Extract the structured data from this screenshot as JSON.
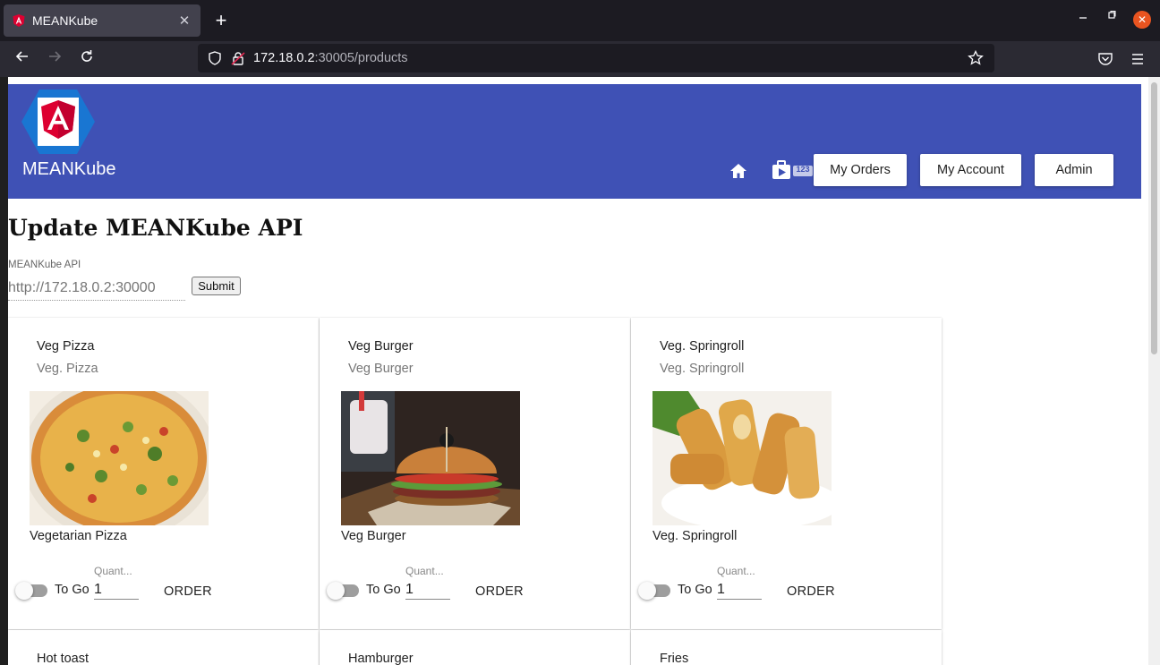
{
  "browser": {
    "tab_title": "MEANKube",
    "tab_close": "✕",
    "new_tab": "+",
    "url_host": "172.18.0.2",
    "url_path": ":30005/products"
  },
  "header": {
    "brand": "MEANKube",
    "buttons": [
      "My Orders",
      "My Account",
      "Admin"
    ],
    "badge": "123",
    "color": "#3f51b5"
  },
  "page": {
    "title": "Update MEANKube API",
    "api_label": "MEANKube API",
    "api_placeholder": "http://172.18.0.2:30000",
    "submit_label": "Submit"
  },
  "products": [
    {
      "title": "Veg Pizza",
      "subtitle": "Veg. Pizza",
      "description": "Vegetarian Pizza",
      "togo_label": "To Go",
      "qty_label": "Quant...",
      "qty": "1",
      "order_label": "ORDER"
    },
    {
      "title": "Veg Burger",
      "subtitle": "Veg Burger",
      "description": "Veg Burger",
      "togo_label": "To Go",
      "qty_label": "Quant...",
      "qty": "1",
      "order_label": "ORDER"
    },
    {
      "title": "Veg. Springroll",
      "subtitle": "Veg. Springroll",
      "description": "Veg. Springroll",
      "togo_label": "To Go",
      "qty_label": "Quant...",
      "qty": "1",
      "order_label": "ORDER"
    },
    {
      "title": "Hot toast"
    },
    {
      "title": "Hamburger"
    },
    {
      "title": "Fries"
    }
  ]
}
